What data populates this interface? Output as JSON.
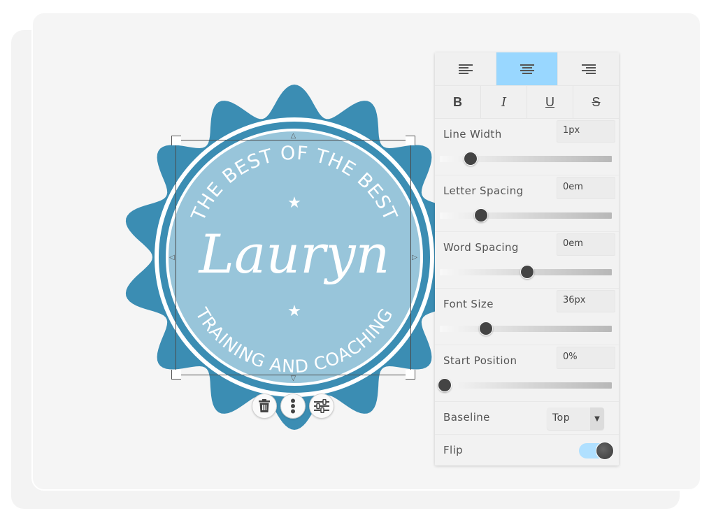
{
  "badge": {
    "top_text": "THE BEST OF THE BEST",
    "name": "Lauryn",
    "bottom_text": "TRAINING AND COACHING",
    "colors": {
      "outer": "#3b8db3",
      "inner": "#98c5da",
      "ring": "#ffffff"
    }
  },
  "selection_actions": [
    {
      "icon": "trash-icon",
      "label": "Delete"
    },
    {
      "icon": "more-vertical-icon",
      "label": "More"
    },
    {
      "icon": "sliders-icon",
      "label": "Adjust"
    }
  ],
  "panel": {
    "alignment": {
      "options": [
        "left",
        "center",
        "right"
      ],
      "active": "center",
      "active_color": "#99d7ff"
    },
    "text_styles": [
      {
        "id": "bold",
        "glyph": "B"
      },
      {
        "id": "italic",
        "glyph": "I"
      },
      {
        "id": "underline",
        "glyph": "U"
      },
      {
        "id": "strikethrough",
        "glyph": "S"
      }
    ],
    "properties": [
      {
        "label": "Line Width",
        "value": "1px",
        "slider_fraction": 0.18
      },
      {
        "label": "Letter Spacing",
        "value": "0em",
        "slider_fraction": 0.24
      },
      {
        "label": "Word Spacing",
        "value": "0em",
        "slider_fraction": 0.51
      },
      {
        "label": "Font Size",
        "value": "36px",
        "slider_fraction": 0.27
      },
      {
        "label": "Start Position",
        "value": "0%",
        "slider_fraction": 0.03
      }
    ],
    "baseline": {
      "label": "Baseline",
      "selected": "Top"
    },
    "flip": {
      "label": "Flip",
      "on": true
    }
  }
}
